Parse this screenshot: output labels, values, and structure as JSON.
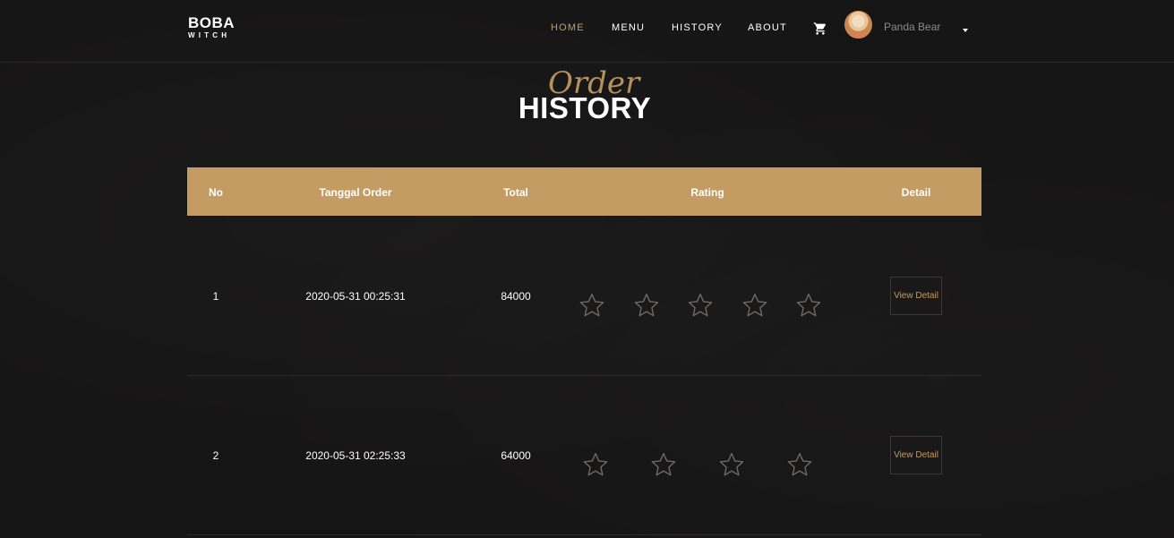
{
  "brand": {
    "top": "BOBA",
    "bottom": "WITCH"
  },
  "nav": {
    "home": "HOME",
    "menu": "MENU",
    "history": "HISTORY",
    "about": "ABOUT",
    "active": "HOME"
  },
  "user": {
    "name": "Panda Bear",
    "cart_icon": "cart-icon",
    "dropdown_icon": "caret-down-icon"
  },
  "heading": {
    "script": "Order",
    "main": "HISTORY"
  },
  "table": {
    "headers": {
      "no": "No",
      "date": "Tanggal Order",
      "total": "Total",
      "rating": "Rating",
      "detail": "Detail"
    },
    "rows": [
      {
        "no": "1",
        "date": "2020-05-31 00:25:31",
        "total": "84000",
        "rating_stars": 5,
        "filled": 0,
        "detail": "View Detail"
      },
      {
        "no": "2",
        "date": "2020-05-31 02:25:33",
        "total": "64000",
        "rating_stars": 4,
        "filled": 0,
        "detail": "View Detail"
      }
    ]
  },
  "colors": {
    "accent": "#c49b63",
    "background": "#161515",
    "text": "#ffffff",
    "muted": "#8e8a85"
  }
}
